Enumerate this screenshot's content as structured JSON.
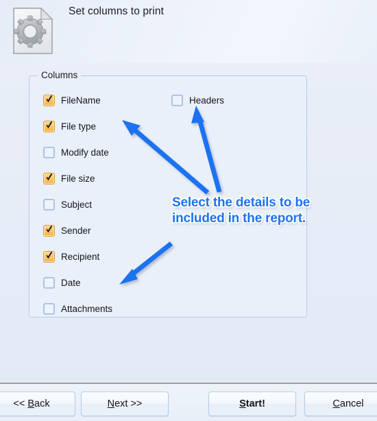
{
  "header": {
    "title": "Set columns to print",
    "icon": "document-gear-icon"
  },
  "columns_group": {
    "legend": "Columns",
    "left_items": [
      {
        "label": "FileName",
        "checked": true
      },
      {
        "label": "File type",
        "checked": true
      },
      {
        "label": "Modify date",
        "checked": false
      },
      {
        "label": "File size",
        "checked": true
      },
      {
        "label": "Subject",
        "checked": false
      },
      {
        "label": "Sender",
        "checked": true
      },
      {
        "label": "Recipient",
        "checked": true
      },
      {
        "label": "Date",
        "checked": false
      },
      {
        "label": "Attachments",
        "checked": false
      }
    ],
    "right_items": [
      {
        "label": "Headers",
        "checked": false
      }
    ]
  },
  "annotation": {
    "text": "Select the details to be included in the report.",
    "color": "#1f72f0",
    "outline_color": "#ffffff",
    "arrows": 3
  },
  "footer": {
    "buttons": [
      {
        "name": "back",
        "prefix": "<< ",
        "accel": "B",
        "suffix": "ack",
        "bold": false
      },
      {
        "name": "next",
        "prefix": "",
        "accel": "N",
        "suffix": "ext >>",
        "bold": false
      },
      {
        "name": "start",
        "prefix": "",
        "accel": "S",
        "suffix": "tart!",
        "bold": true
      },
      {
        "name": "cancel",
        "prefix": "",
        "accel": "C",
        "suffix": "ancel",
        "bold": false
      }
    ]
  },
  "colors": {
    "checked_checkbox": "#f7bd56",
    "unchecked_border": "#a9c4e8",
    "group_border": "#b6cbe8",
    "panel_bg": "#e9eef8",
    "annotation_blue": "#1f72f0"
  }
}
